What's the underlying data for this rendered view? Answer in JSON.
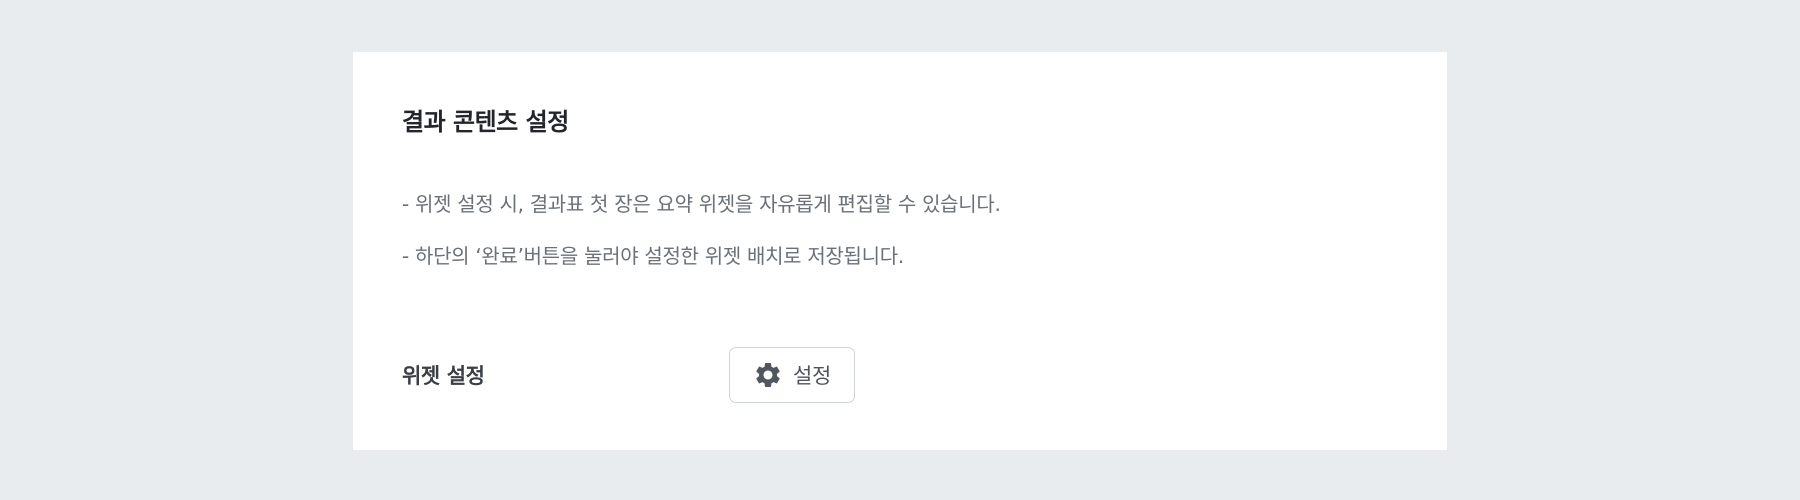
{
  "card": {
    "title": "결과 콘텐츠 설정",
    "descriptions": [
      "- 위젯 설정 시, 결과표 첫 장은 요약 위젯을 자유롭게 편집할 수 있습니다.",
      "- 하단의 ‘완료’버튼을 눌러야 설정한 위젯 배치로 저장됩니다."
    ]
  },
  "widget_setting": {
    "label": "위젯 설정",
    "button": {
      "label": "설정",
      "icon": "gear-icon"
    }
  }
}
